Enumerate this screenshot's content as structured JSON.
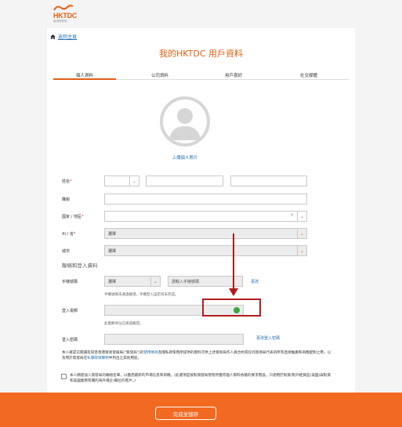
{
  "brand": {
    "logo_text": "HKTDC",
    "logo_sub": "香港貿發局",
    "accent": "#e06016"
  },
  "breadcrumb": {
    "label": "返回主頁"
  },
  "page_title": "我的HKTDC 用戶資料",
  "tabs": [
    {
      "label": "個人資料",
      "active": true
    },
    {
      "label": "公司資料",
      "active": false
    },
    {
      "label": "用戶喜好",
      "active": false
    },
    {
      "label": "社交媒體",
      "active": false
    }
  ],
  "avatar": {
    "upload_label": "上傳個人照片"
  },
  "form": {
    "name_label": "姓名",
    "title_label": "職銜",
    "country_label": "國家 / 地區",
    "country_clear": "×",
    "province_label": "州 / 省",
    "province_value": "選擇",
    "city_label": "城市",
    "city_value": "選擇",
    "section_login": "聯絡和登入資料",
    "mobile_label": "手機號碼",
    "mobile_code_value": "選擇",
    "mobile_placeholder": "請輸入手機號碼",
    "mobile_change": "更改",
    "mobile_hint": "手機號碼未通過驗證，手機登入設定尚未完成。",
    "email_label": "登入電郵",
    "email_hint": "此電郵地址已通過驗證。",
    "password_label": "登入密碼",
    "password_change": "更改登入密碼",
    "required_mark": "*"
  },
  "notes": {
    "privacy_before": "本人確認已閱讀及同意香港貿易發展局(\"貿發局\")的",
    "privacy_link1": "使用條款",
    "privacy_mid": "及隱私政策而所提供的資料可供上述貿易局作人員合約或任何貿易局代表的所有直接推廣和商機配對之用，以及用於貿發局在",
    "privacy_link2": "私隱政策聲明",
    "privacy_after": "中列出之其他用途。",
    "consent": "本人願意加入貿發局的聯絡名單，以獲悉最新的市場信息和商機。(此選項是按對貿發局現有所獲得個人資料依循的要求而設，只適用於對貿/對外經貿區(美國)與對貿和美國業務有關的海外場企)職位的客戶。)"
  },
  "footer": {
    "submit_label": "完成並儲存"
  }
}
